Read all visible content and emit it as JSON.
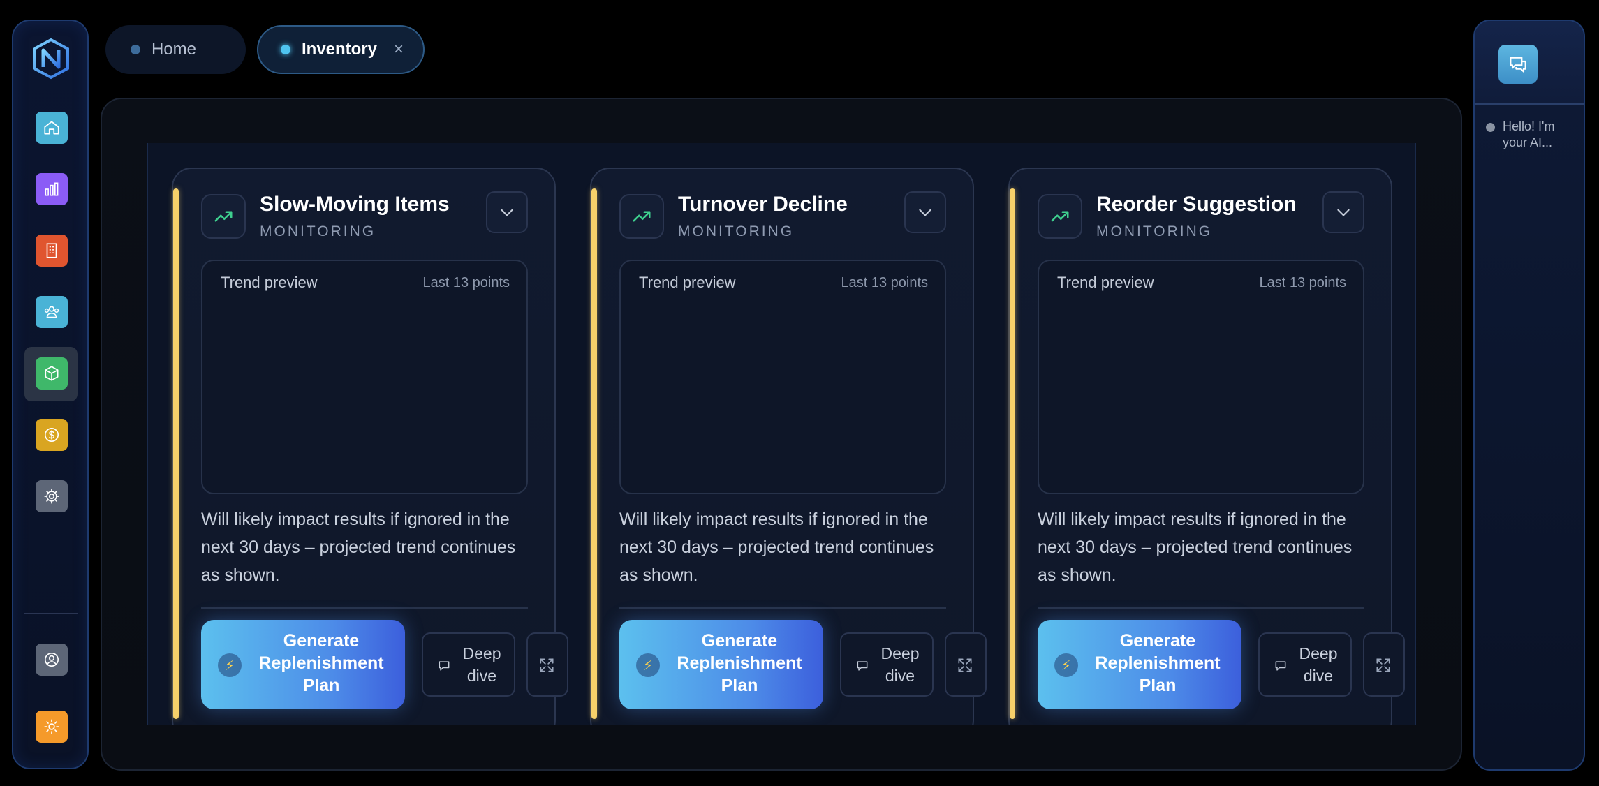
{
  "sidebar": {
    "logo": "N",
    "nav": [
      {
        "name": "home-icon",
        "color": "#4ab3d6"
      },
      {
        "name": "bar-chart-icon",
        "color": "#8b5cf6"
      },
      {
        "name": "building-icon",
        "color": "#e0552f"
      },
      {
        "name": "users-icon",
        "color": "#4ab3d6"
      },
      {
        "name": "box-icon",
        "color": "#3fb86a",
        "active": true
      },
      {
        "name": "dollar-icon",
        "color": "#d9a521"
      },
      {
        "name": "gear-icon",
        "color": "#5d6677"
      }
    ],
    "bottom": [
      {
        "name": "user-profile-icon",
        "color": "#5d6677"
      },
      {
        "name": "sun-icon",
        "color": "#f59a2a"
      }
    ]
  },
  "tabs": [
    {
      "label": "Home",
      "active": false
    },
    {
      "label": "Inventory",
      "active": true,
      "close": "×"
    }
  ],
  "cards": [
    {
      "title": "Slow-Moving Items",
      "status": "MONITORING",
      "trend_label": "Trend preview",
      "trend_count": "Last 13 points",
      "description": "Will likely impact results if ignored in the next 30 days – projected trend continues as shown.",
      "primary_action": "Generate Replenishment Plan",
      "secondary_action": "Deep dive"
    },
    {
      "title": "Turnover Decline",
      "status": "MONITORING",
      "trend_label": "Trend preview",
      "trend_count": "Last 13 points",
      "description": "Will likely impact results if ignored in the next 30 days – projected trend continues as shown.",
      "primary_action": "Generate Replenishment Plan",
      "secondary_action": "Deep dive"
    },
    {
      "title": "Reorder Suggestion",
      "status": "MONITORING",
      "trend_label": "Trend preview",
      "trend_count": "Last 13 points",
      "description": "Will likely impact results if ignored in the next 30 days – projected trend continues as shown.",
      "primary_action": "Generate Replenishment Plan",
      "secondary_action": "Deep dive"
    }
  ],
  "chat": {
    "message": "Hello! I'm your AI..."
  },
  "colors": {
    "accent": "#f6d06a",
    "primary_button_start": "#5cc0ee",
    "primary_button_end": "#3c5fdc",
    "trend_arrow": "#3ecf8e"
  }
}
